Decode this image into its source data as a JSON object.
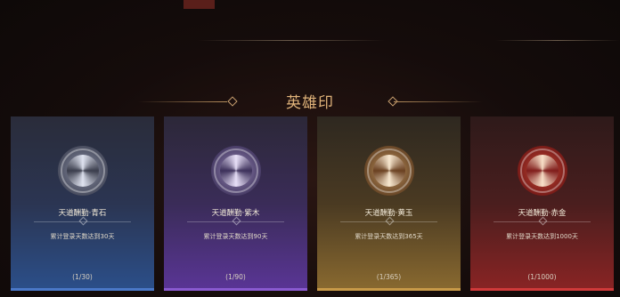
{
  "section_title": "英雄印",
  "cards": [
    {
      "name": "天道酬勤·青石",
      "desc": "累计登录天数达到30天",
      "progress": "(1/30)"
    },
    {
      "name": "天道酬勤·紫木",
      "desc": "累计登录天数达到90天",
      "progress": "(1/90)"
    },
    {
      "name": "天道酬勤·黄玉",
      "desc": "累计登录天数达到365天",
      "progress": "(1/365)"
    },
    {
      "name": "天道酬勤·赤金",
      "desc": "累计登录天数达到1000天",
      "progress": "(1/1000)"
    }
  ],
  "colors": {
    "title": "#e0b37a",
    "tier_blue": "#4a78c8",
    "tier_purple": "#8a5ad0",
    "tier_gold": "#c89a48",
    "tier_red": "#d03a3a"
  },
  "icons": {
    "emblem": "hero-seal-emblem-icon",
    "divider": "diamond-ornament-icon"
  }
}
